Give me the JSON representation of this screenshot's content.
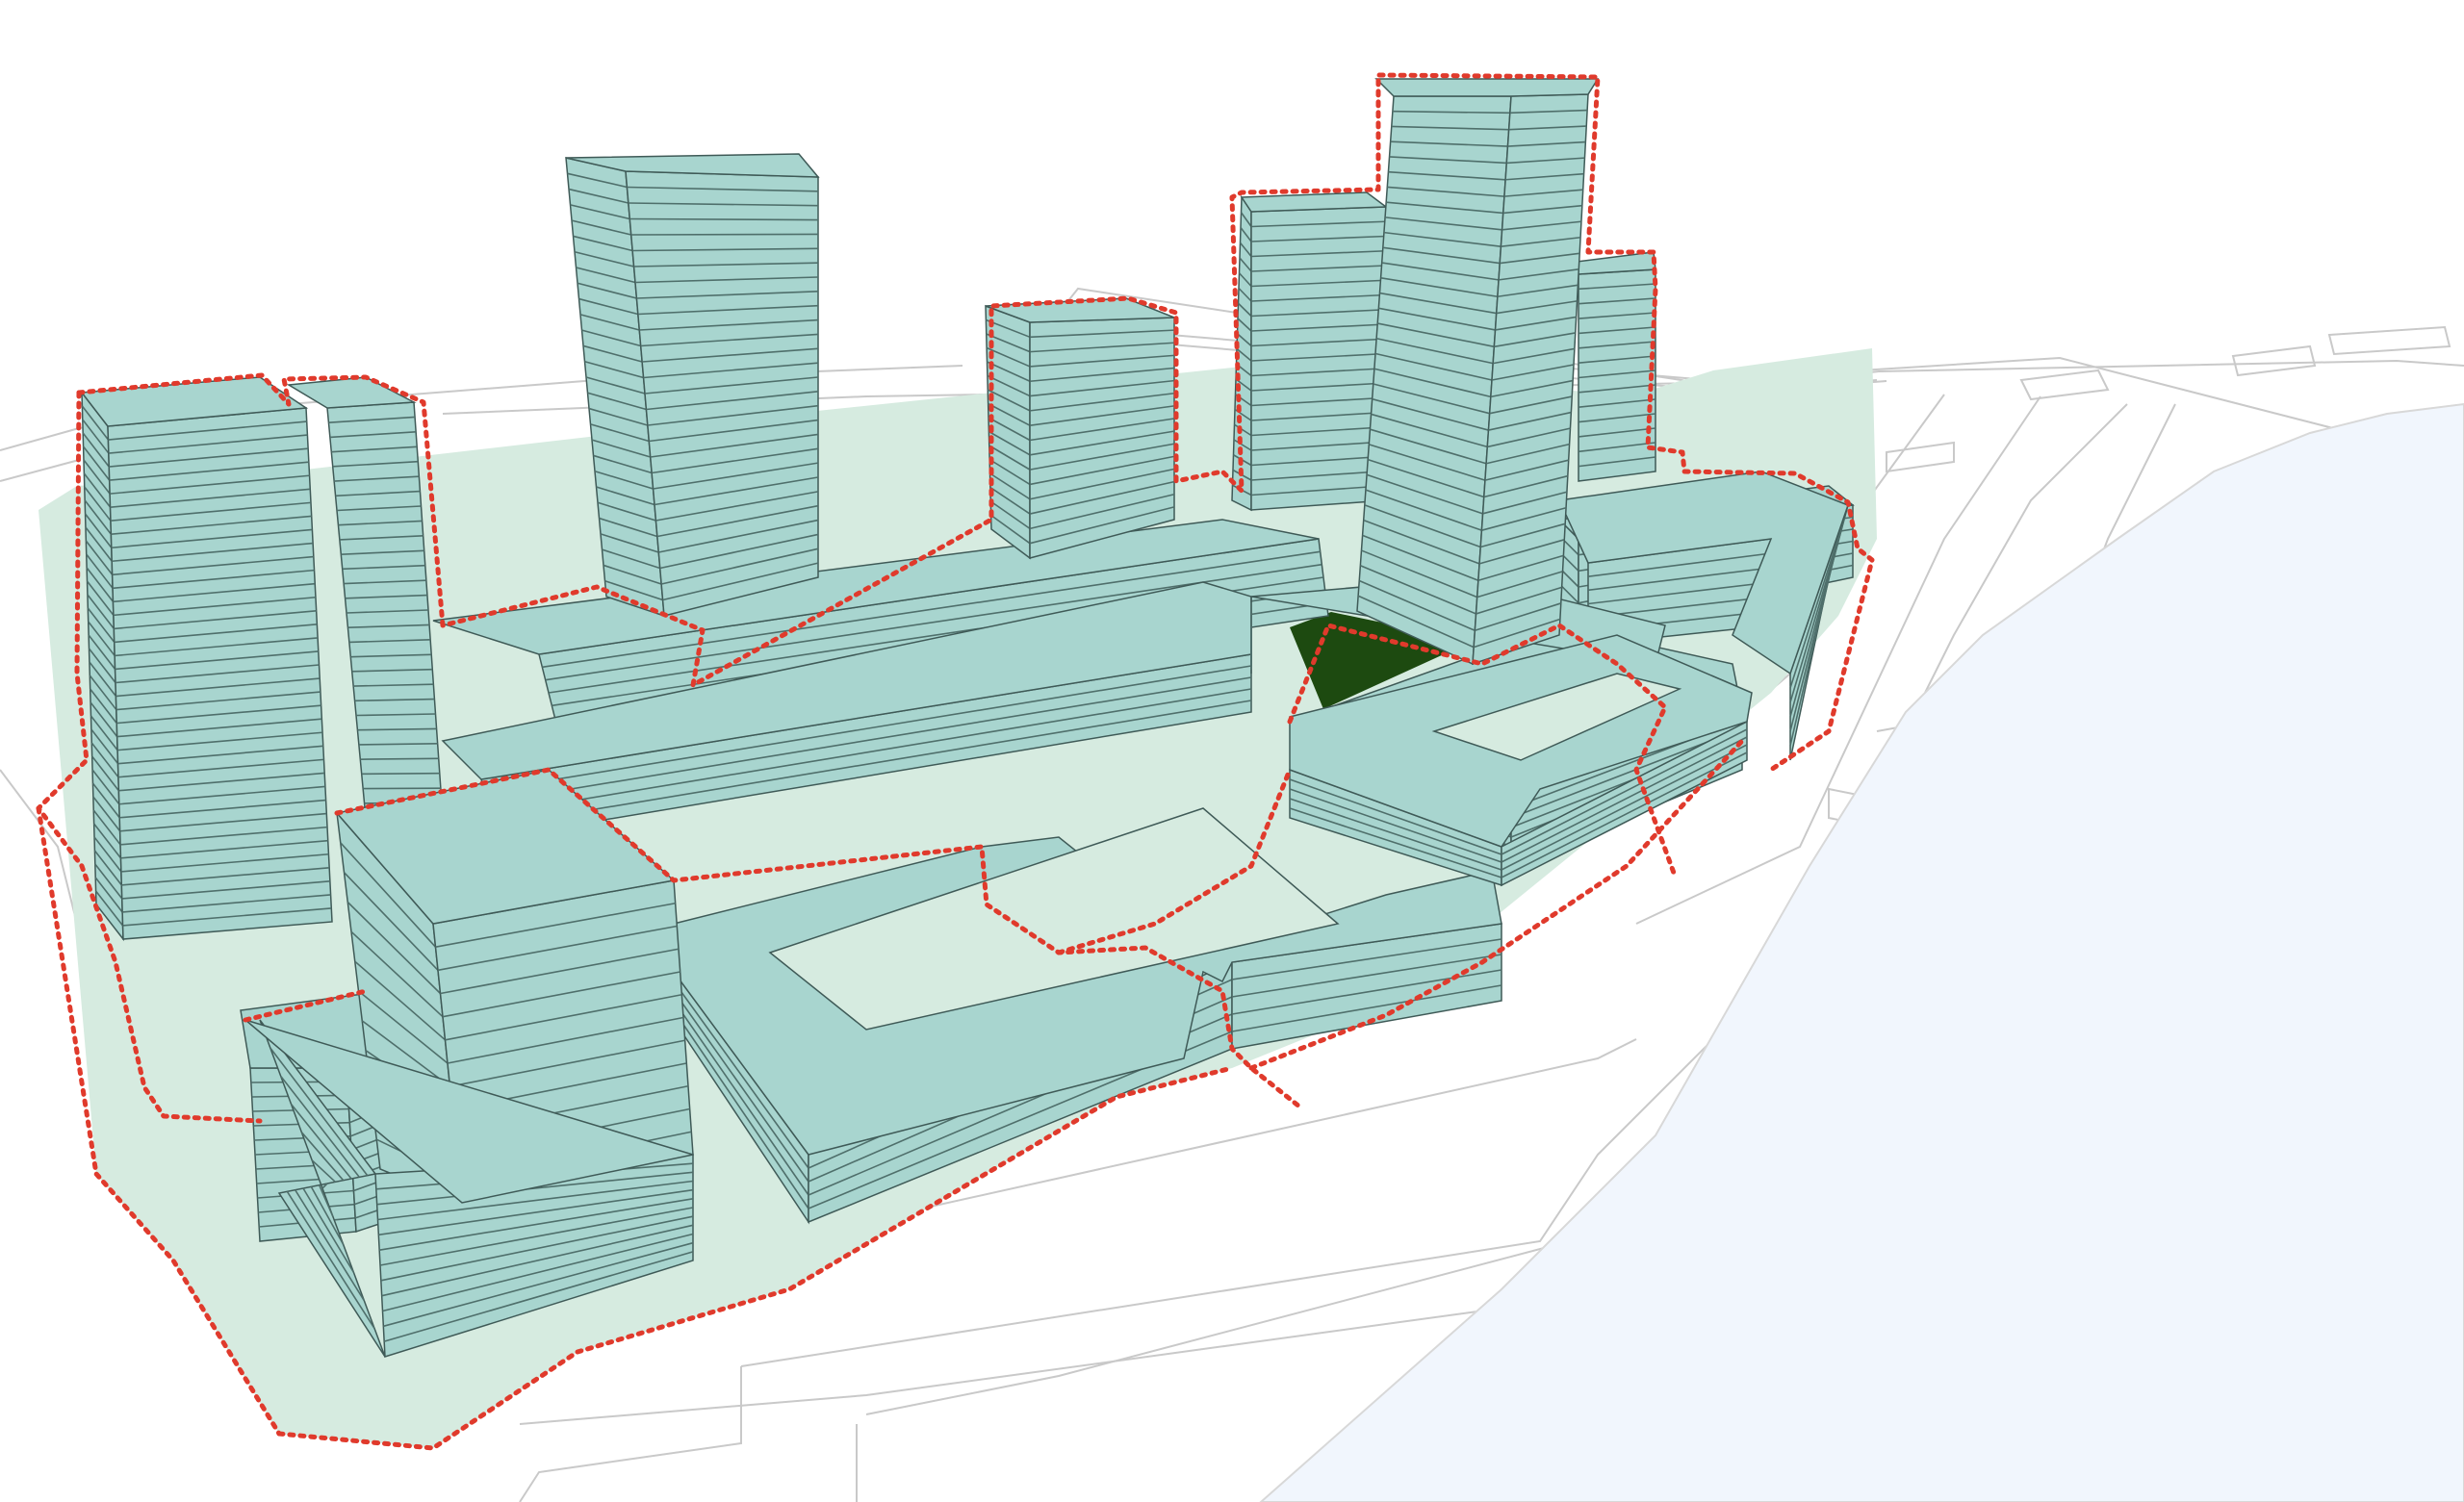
{
  "colors": {
    "background": "#ffffff",
    "site_fill": "#d6ebe0",
    "building_face": "#a8d5cf",
    "floor_line": "#4f6f6b",
    "edge": "#3f5a57",
    "boundary": "#e03a2c",
    "context_line": "#c9c9c9",
    "water": "#f1f6fd",
    "courtyard_green": "#1d4a10"
  },
  "icons": {
    "boundary": "dotted-red-outline",
    "water": "river-shape"
  }
}
